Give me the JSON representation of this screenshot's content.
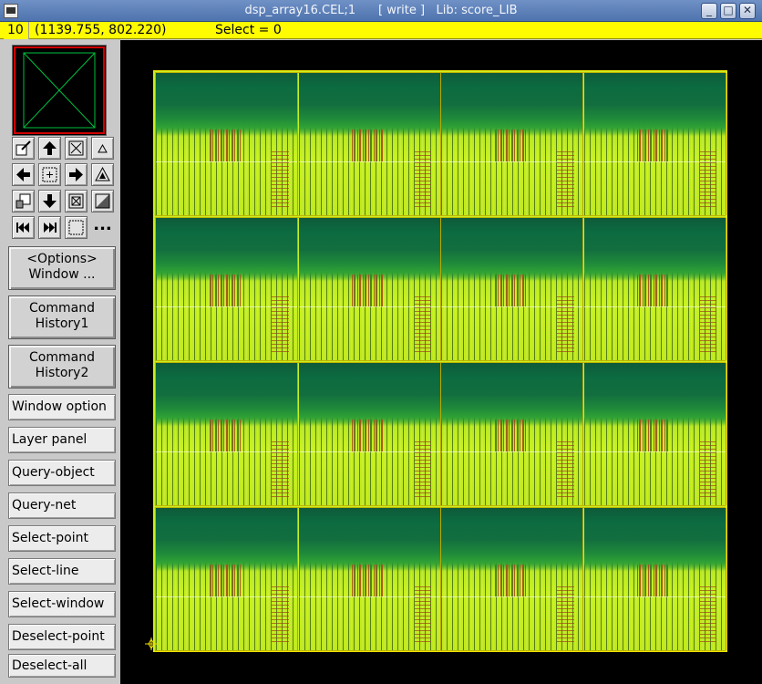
{
  "window": {
    "title": "dsp_array16.CEL;1      [ write ]   Lib: score_LIB",
    "controls": [
      "_",
      "□",
      "✕"
    ]
  },
  "status": {
    "count": "10",
    "coords": "(1139.755, 802.220)",
    "select": "Select = 0"
  },
  "tools": {
    "icons": [
      "zoom-select-icon",
      "pan-up-icon",
      "fit-icon",
      "zoom-in-small-icon",
      "pan-left-icon",
      "center-icon",
      "pan-right-icon",
      "zoom-in-icon",
      "zoom-region-icon",
      "pan-down-icon",
      "redraw-icon",
      "zoom-out-icon",
      "first-icon",
      "last-icon",
      "window-icon",
      "more-icon"
    ],
    "more_label": "..."
  },
  "commands": [
    {
      "line1": "<Options>",
      "line2": "Window ..."
    },
    {
      "line1": "Command",
      "line2": "History1"
    },
    {
      "line1": "Command",
      "line2": "History2"
    }
  ],
  "menu": [
    "Window option",
    "Layer panel",
    "Query-object",
    "Query-net",
    "Select-point",
    "Select-line",
    "Select-window",
    "Deselect-point",
    "Deselect-all"
  ],
  "layout_view": {
    "rows": 4,
    "cols": 4,
    "colors": {
      "background": "#000000",
      "boundary": "#f0e000",
      "fill": "#c8f020",
      "dense": "#0e5a3a",
      "metal": "#a4461c"
    }
  }
}
